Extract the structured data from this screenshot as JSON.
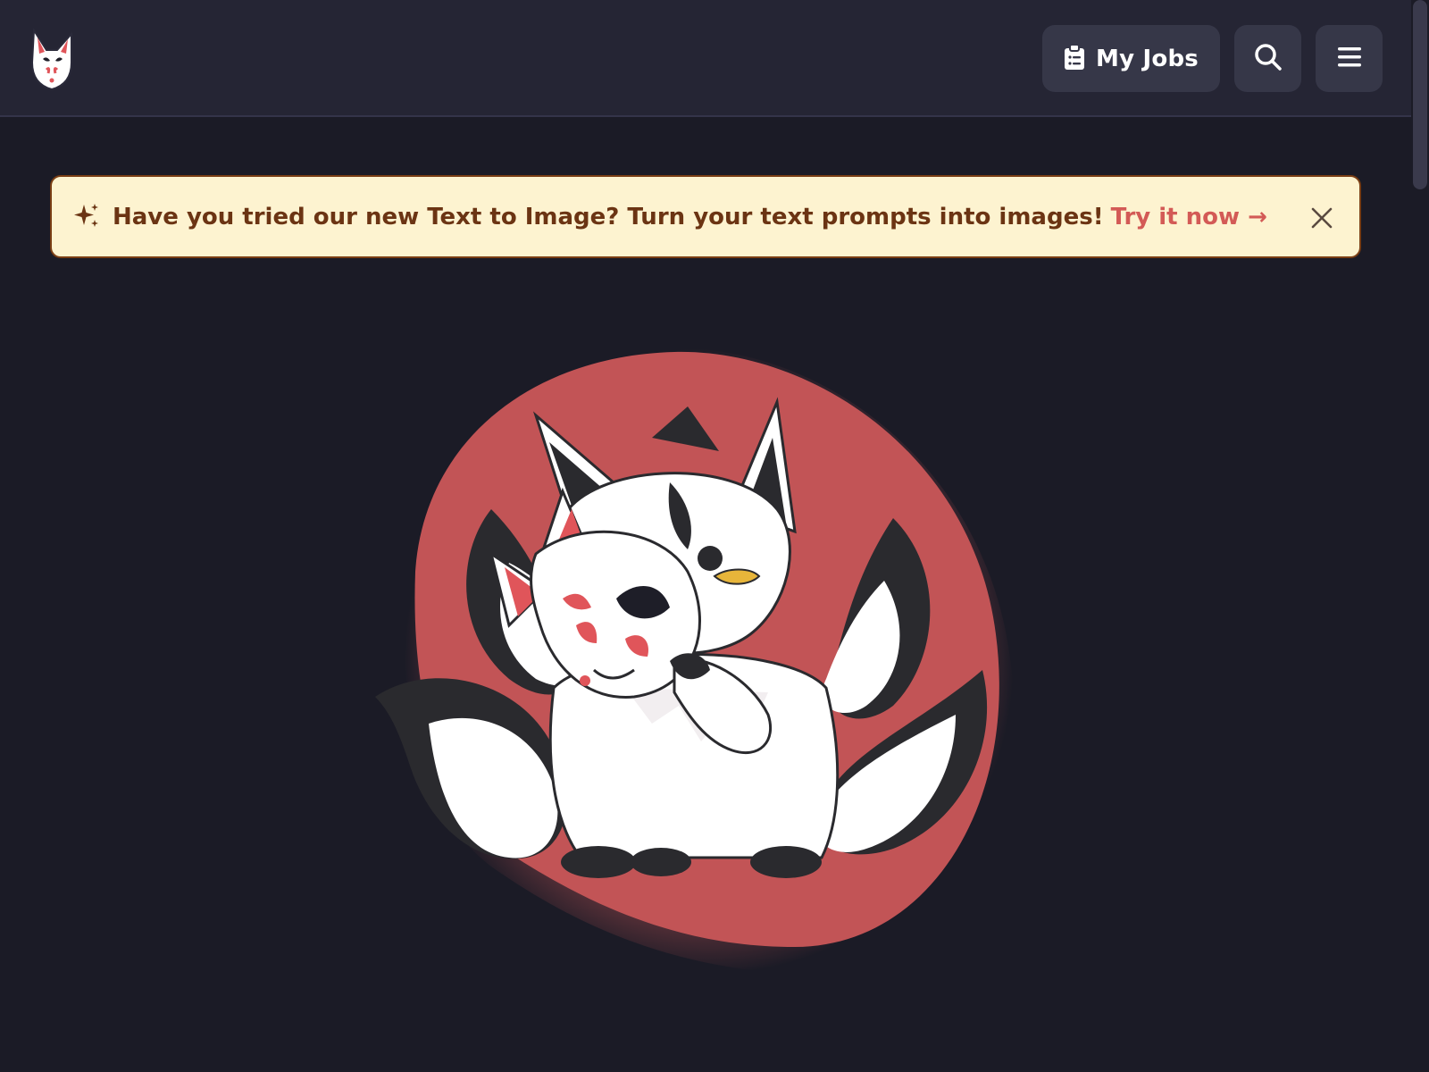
{
  "header": {
    "logo_icon": "fox-mask-logo",
    "my_jobs_label": "My Jobs",
    "my_jobs_icon": "clipboard-list-icon",
    "search_icon": "search-icon",
    "menu_icon": "hamburger-menu-icon"
  },
  "banner": {
    "icon": "sparkles-icon",
    "message": "Have you tried our new Text to Image? Turn your text prompts into images!",
    "link_label": "Try it now →",
    "close_icon": "close-icon"
  },
  "hero": {
    "illustration": "kitsune-fox-with-mask"
  },
  "colors": {
    "background": "#1b1b26",
    "header": "#252534",
    "button": "#363748",
    "banner_bg": "#fdf3d0",
    "banner_text": "#6b3413",
    "accent": "#d35a56",
    "blob": "#c25456"
  }
}
